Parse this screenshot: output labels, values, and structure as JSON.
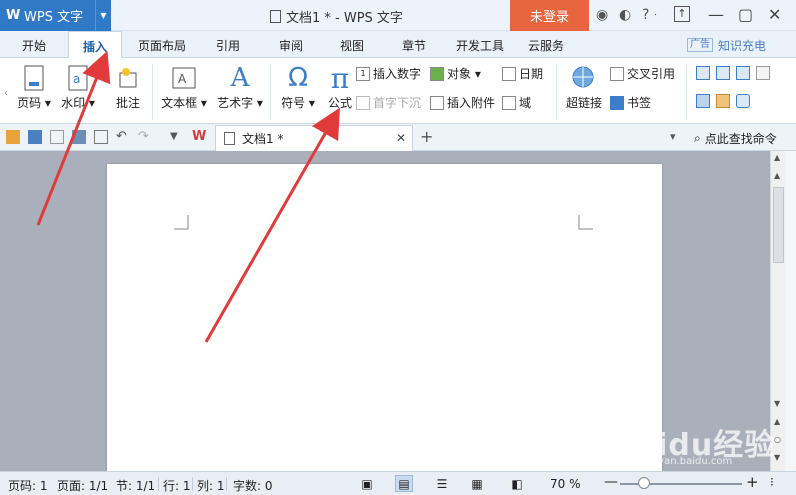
{
  "app": {
    "name": "WPS 文字",
    "logo": "W"
  },
  "window": {
    "title": "文档1 * - WPS 文字",
    "login_label": "未登录"
  },
  "tabs": [
    "开始",
    "插入",
    "页面布局",
    "引用",
    "审阅",
    "视图",
    "章节",
    "开发工具",
    "云服务"
  ],
  "active_tab": "插入",
  "ad": {
    "badge": "广告",
    "text": "知识充电"
  },
  "ribbon": {
    "page_number": "页码",
    "watermark": "水印",
    "comment": "批注",
    "textbox": "文本框",
    "wordart": "艺术字",
    "symbol": "符号",
    "formula": "公式",
    "insert_number": "插入数字",
    "object": "对象",
    "date": "日期",
    "drop_cap": "首字下沉",
    "insert_attachment": "插入附件",
    "field": "域",
    "hyperlink": "超链接",
    "cross_reference": "交叉引用",
    "bookmark": "书签",
    "symbol_glyph": "Ω",
    "formula_glyph": "π",
    "wordart_glyph": "A"
  },
  "doc_tab": {
    "name": "文档1 *"
  },
  "search": {
    "label": "点此查找命令"
  },
  "status": {
    "page_num": "页码: 1",
    "pages": "页面: 1/1",
    "section": "节: 1/1",
    "row": "行: 1",
    "col": "列: 1",
    "word_count": "字数: 0",
    "zoom": "70 %",
    "zoom_fraction": 0.2
  },
  "watermark": {
    "brand": "Baidu经验",
    "url": "jingyan.baidu.com"
  },
  "colors": {
    "accent": "#2f79c7",
    "login": "#e8653f",
    "arrow": "#e03a3a"
  }
}
